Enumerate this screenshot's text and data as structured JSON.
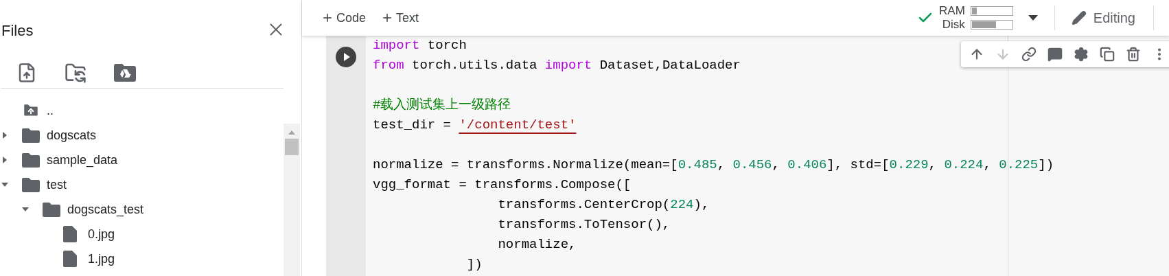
{
  "sidebar": {
    "title": "Files",
    "tools": [
      {
        "kind": "upload"
      },
      {
        "kind": "refresh"
      },
      {
        "kind": "drive"
      }
    ],
    "tree": [
      {
        "name": "..",
        "kind": "parent"
      },
      {
        "name": "dogscats",
        "kind": "folder",
        "expanded": false
      },
      {
        "name": "sample_data",
        "kind": "folder",
        "expanded": false
      },
      {
        "name": "test",
        "kind": "folder",
        "expanded": true,
        "children": [
          {
            "name": "dogscats_test",
            "kind": "folder",
            "expanded": true,
            "children": [
              {
                "name": "0.jpg",
                "kind": "file"
              },
              {
                "name": "1.jpg",
                "kind": "file"
              }
            ]
          }
        ]
      }
    ]
  },
  "toolbar": {
    "buttons": [
      {
        "label": "Code"
      },
      {
        "label": "Text"
      }
    ],
    "resources": [
      {
        "label": "RAM",
        "level": 0.12
      },
      {
        "label": "Disk",
        "level": 0.6
      }
    ],
    "mode": "Editing"
  },
  "cell_toolbar": [
    {
      "kind": "up",
      "disabled": false
    },
    {
      "kind": "down",
      "disabled": true
    },
    {
      "kind": "link",
      "disabled": false
    },
    {
      "kind": "comment",
      "disabled": false
    },
    {
      "kind": "settings",
      "disabled": false
    },
    {
      "kind": "mirror",
      "disabled": false
    },
    {
      "kind": "delete",
      "disabled": false
    },
    {
      "kind": "more",
      "disabled": false
    }
  ],
  "code": [
    [
      {
        "kind": "keyword",
        "text": "import"
      },
      {
        "kind": "plain",
        "text": " torch"
      }
    ],
    [
      {
        "kind": "keyword",
        "text": "from"
      },
      {
        "kind": "plain",
        "text": " torch.utils.data "
      },
      {
        "kind": "keyword",
        "text": "import"
      },
      {
        "kind": "plain",
        "text": " Dataset,DataLoader"
      }
    ],
    [
      {
        "kind": "blank"
      },
      {
        "kind": "comment",
        "text": "#载入测试集上一级路径"
      }
    ],
    [
      {
        "kind": "plain",
        "text": "test_dir = "
      },
      {
        "kind": "string",
        "text": "'/content/test'"
      }
    ],
    [
      {
        "kind": "blank"
      },
      {
        "kind": "plain",
        "text": "normalize = transforms.Normalize(mean=["
      },
      {
        "kind": "number",
        "text": "0.485"
      },
      {
        "kind": "plain",
        "text": ", "
      },
      {
        "kind": "number",
        "text": "0.456"
      },
      {
        "kind": "plain",
        "text": ", "
      },
      {
        "kind": "number",
        "text": "0.406"
      },
      {
        "kind": "plain",
        "text": "], std=["
      },
      {
        "kind": "number",
        "text": "0.229"
      },
      {
        "kind": "plain",
        "text": ", "
      },
      {
        "kind": "number",
        "text": "0.224"
      },
      {
        "kind": "plain",
        "text": ", "
      },
      {
        "kind": "number",
        "text": "0.225"
      },
      {
        "kind": "plain",
        "text": "])"
      }
    ],
    [
      {
        "kind": "plain",
        "text": "vgg_format = transforms.Compose(["
      }
    ],
    [
      {
        "kind": "plain",
        "text": "                transforms.CenterCrop("
      },
      {
        "kind": "number",
        "text": "224"
      },
      {
        "kind": "plain",
        "text": "),"
      }
    ],
    [
      {
        "kind": "plain",
        "text": "                transforms.ToTensor(),"
      }
    ],
    [
      {
        "kind": "plain",
        "text": "                normalize,"
      }
    ],
    [
      {
        "kind": "plain",
        "text": "            ])"
      }
    ]
  ]
}
